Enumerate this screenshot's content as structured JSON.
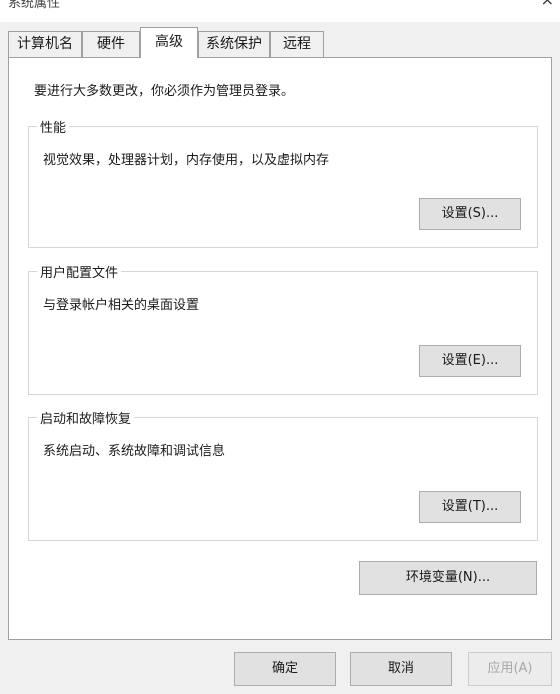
{
  "window": {
    "title": "系统属性",
    "close_glyph": "×"
  },
  "tabs": [
    {
      "label": "计算机名",
      "active": false
    },
    {
      "label": "硬件",
      "active": false
    },
    {
      "label": "高级",
      "active": true
    },
    {
      "label": "系统保护",
      "active": false
    },
    {
      "label": "远程",
      "active": false
    }
  ],
  "notice": "要进行大多数更改，你必须作为管理员登录。",
  "groups": [
    {
      "title": "性能",
      "description": "视觉效果，处理器计划，内存使用，以及虚拟内存",
      "button_label": "设置(S)..."
    },
    {
      "title": "用户配置文件",
      "description": "与登录帐户相关的桌面设置",
      "button_label": "设置(E)..."
    },
    {
      "title": "启动和故障恢复",
      "description": "系统启动、系统故障和调试信息",
      "button_label": "设置(T)..."
    }
  ],
  "env_button_label": "环境变量(N)...",
  "footer": {
    "ok_label": "确定",
    "cancel_label": "取消",
    "apply_label": "应用(A)"
  },
  "colors": {
    "window_bg": "#f0f0f0",
    "panel_bg": "#ffffff",
    "button_bg": "#e1e1e1",
    "button_border": "#adadad",
    "disabled_text": "#a8a8a8"
  }
}
